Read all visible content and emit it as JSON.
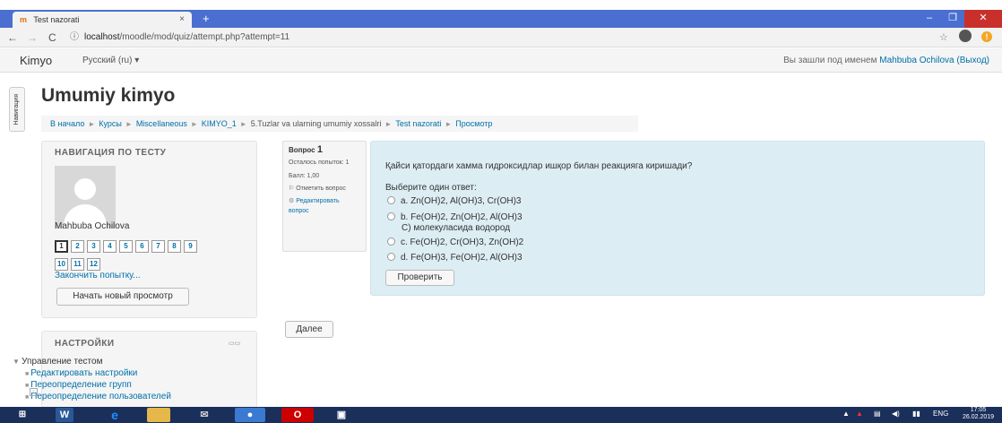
{
  "browser": {
    "tab_title": "Test nazorati",
    "tab_close": "×",
    "new_tab": "+",
    "win_minimize": "–",
    "win_restore": "❐",
    "win_close": "✕",
    "url_info": "ⓘ",
    "url_host": "localhost",
    "url_path": "/moodle/mod/quiz/attempt.php?attempt=11",
    "icons": [
      "back-arrow-icon",
      "forward-arrow-icon",
      "reload-icon",
      "info-icon",
      "star-icon",
      "account-icon",
      "alert-icon"
    ]
  },
  "moodle": {
    "brand": "Kimyo",
    "language": "Русский (ru) ▾",
    "login_prefix": "Вы зашли под именем",
    "login_user": "Mahbuba Ochilova",
    "logout": "(Выход)"
  },
  "block_tab_label": "Навигация",
  "page_title": "Umumiy kimyo",
  "breadcrumb": [
    "В начало",
    "Курсы",
    "Miscellaneous",
    "KIMYO_1",
    "5.Tuzlar va ularning umumiy xossalri",
    "Test nazorati",
    "Просмотр"
  ],
  "quiz_nav": {
    "title": "НАВИГАЦИЯ ПО ТЕСТУ",
    "user_name": "Mahbuba Ochilova",
    "questions": [
      "1",
      "2",
      "3",
      "4",
      "5",
      "6",
      "7",
      "8",
      "9",
      "10",
      "11",
      "12"
    ],
    "current_question": "1",
    "finish_link": "Закончить попытку...",
    "new_preview_button": "Начать новый просмотр"
  },
  "question_info": {
    "label": "Вопрос",
    "number": "1",
    "attempts_left": "Осталось попыток: 1",
    "score": "Балл: 1,00",
    "flag": "Отметить вопрос",
    "edit": "Редактировать вопрос"
  },
  "question": {
    "text": "Қайси қатордаги хамма гидроксидлар ишқор билан реакцияга киришади?",
    "prompt": "Выберите один ответ:",
    "answers": [
      "a. Zn(OH)2, Al(OH)3, Cr(OH)3",
      "b. Fe(OH)2, Zn(OH)2, Al(OH)3",
      "c. Fe(OH)2, Cr(OH)3, Zn(OH)2",
      "d. Fe(OH)3, Fe(OH)2, Al(OH)3"
    ],
    "answer_b_extra": "С) молекуласида водород",
    "check_button": "Проверить"
  },
  "next_button": "Далее",
  "settings": {
    "title": "НАСТРОЙКИ",
    "section": "Управление тестом",
    "links": [
      "Редактировать настройки",
      "Переопределение групп",
      "Переопределение пользователей"
    ]
  },
  "taskbar": {
    "lang": "ENG",
    "time": "17:05",
    "date": "26.02.2019"
  },
  "colors": {
    "tabbar": "#4a6fd1",
    "link": "#0070a8",
    "question_bg": "#dcedf4",
    "taskbar": "#1a2f5a"
  }
}
